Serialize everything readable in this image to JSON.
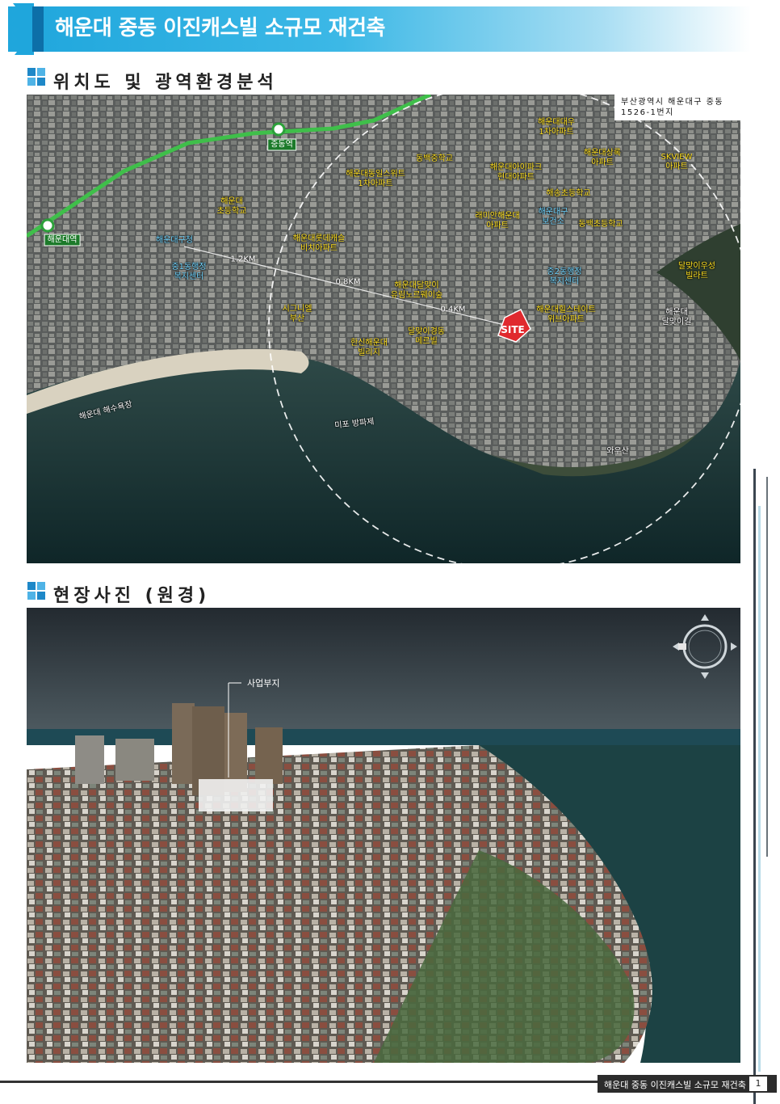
{
  "header": {
    "title": "해운대 중동 이진캐스빌 소규모 재건축"
  },
  "sections": {
    "location": "위치도 및 광역환경분석",
    "site_photo": "현장사진 (원경)"
  },
  "map": {
    "address_line1": "부산광역시 해운대구 중동",
    "address_line2": "1526-1번지",
    "site_marker": "SITE",
    "stations": [
      {
        "name": "중동역"
      },
      {
        "name": "해운대역"
      }
    ],
    "distances": [
      {
        "label": "1.2KM"
      },
      {
        "label": "0.8KM"
      },
      {
        "label": "0.4KM"
      }
    ],
    "labels": [
      {
        "text": "해운대대우\n1차아파트",
        "color": "#ffe020"
      },
      {
        "text": "동백중학교",
        "color": "#ffe020"
      },
      {
        "text": "해운대상록\n아파트",
        "color": "#ffe020"
      },
      {
        "text": "SKVIEW\n아파트",
        "color": "#ffe020"
      },
      {
        "text": "해운대동일스위트\n1차아파트",
        "color": "#ffe020"
      },
      {
        "text": "해운대아이파크\n현대아파트",
        "color": "#ffe020"
      },
      {
        "text": "해송초등학교",
        "color": "#ffe020"
      },
      {
        "text": "해운대\n초등학교",
        "color": "#ffe020"
      },
      {
        "text": "래미안해운대\n아파트",
        "color": "#ffe020"
      },
      {
        "text": "해운대구\n보건소",
        "color": "#6fd4ff"
      },
      {
        "text": "동백초등학교",
        "color": "#ffe020"
      },
      {
        "text": "해운대구청",
        "color": "#6fd4ff"
      },
      {
        "text": "해운대롯데캐슬\n비치아파트",
        "color": "#ffe020"
      },
      {
        "text": "중1동행정\n복지센터",
        "color": "#6fd4ff"
      },
      {
        "text": "중2동행정\n복지센터",
        "color": "#6fd4ff"
      },
      {
        "text": "달맞이우성\n빌라트",
        "color": "#ffe020"
      },
      {
        "text": "해운대달맞이\n유림노르웨이숲",
        "color": "#ffe020"
      },
      {
        "text": "시그니엘\n부산",
        "color": "#ffe020"
      },
      {
        "text": "해운대힐스테이트\n위브아파트",
        "color": "#ffe020"
      },
      {
        "text": "해운대\n달맞이길",
        "color": "#ffffff"
      },
      {
        "text": "한신해운대\n빌리지",
        "color": "#ffe020"
      },
      {
        "text": "달맞이경동\n메르빌",
        "color": "#ffe020"
      },
      {
        "text": "해운대 해수욕장",
        "color": "#ffffff"
      },
      {
        "text": "미포 방파제",
        "color": "#ffffff"
      },
      {
        "text": "와우산",
        "color": "#ffffff"
      }
    ]
  },
  "photo": {
    "site_label": "사업부지"
  },
  "footer": {
    "project": "해운대 중동 이진캐스빌 소규모 재건축",
    "page": "1"
  }
}
